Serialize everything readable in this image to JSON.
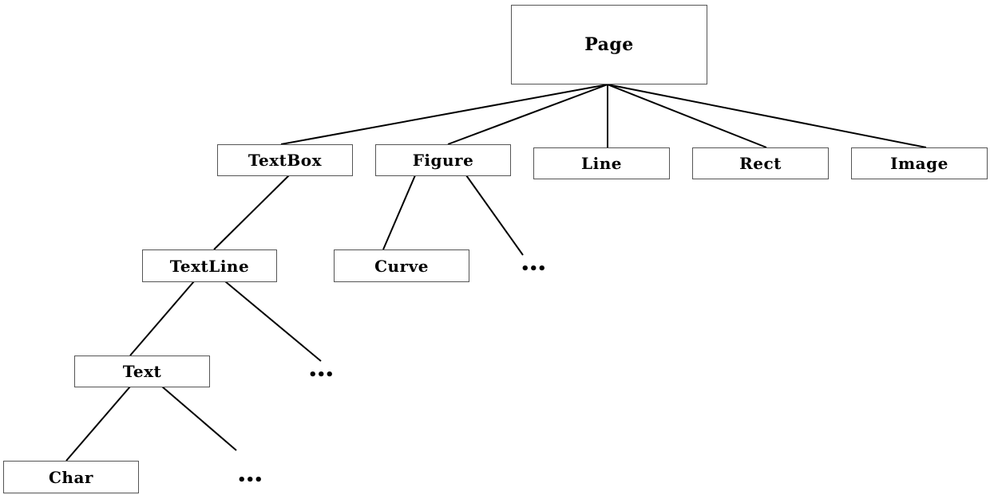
{
  "diagram": {
    "type": "tree",
    "colors": {
      "line": "#000000",
      "box_border": "#555555",
      "text": "#000000",
      "background": "#ffffff"
    },
    "nodes": {
      "page": "Page",
      "textbox": "TextBox",
      "figure": "Figure",
      "line": "Line",
      "rect": "Rect",
      "image": "Image",
      "textline": "TextLine",
      "curve": "Curve",
      "text": "Text",
      "char": "Char"
    },
    "ellipsis": "•••",
    "edges": [
      [
        "page",
        "textbox"
      ],
      [
        "page",
        "figure"
      ],
      [
        "page",
        "line"
      ],
      [
        "page",
        "rect"
      ],
      [
        "page",
        "image"
      ],
      [
        "textbox",
        "textline"
      ],
      [
        "figure",
        "curve"
      ],
      [
        "figure",
        "figure-more"
      ],
      [
        "textline",
        "text"
      ],
      [
        "textline",
        "textline-more"
      ],
      [
        "text",
        "char"
      ],
      [
        "text",
        "text-more"
      ]
    ]
  }
}
